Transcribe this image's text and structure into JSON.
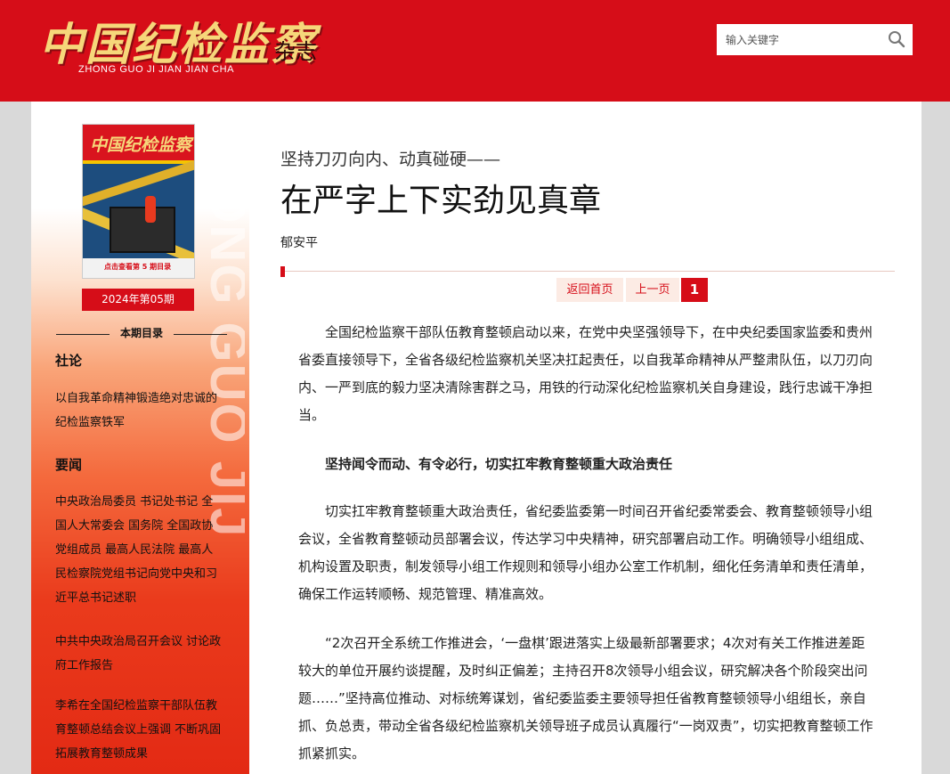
{
  "header": {
    "logo_cn": "中国纪检监察",
    "logo_pinyin": "ZHONG GUO JI JIAN JIAN CHA",
    "logo_suffix": "杂志",
    "search_placeholder": "输入关键字",
    "brand_color": "#d60d18"
  },
  "sidebar": {
    "watermark": "ZHONG GUO JIJ",
    "cover": {
      "title": "中国纪检监察",
      "link_text": "点击查看第 5 期目录"
    },
    "issue_label": "2024年第05期",
    "toc_title": "本期目录",
    "sections": [
      {
        "name": "社论",
        "items": [
          "以自我革命精神锻造绝对忠诚的纪检监察铁军"
        ]
      },
      {
        "name": "要闻",
        "items": [
          "中央政治局委员 书记处书记 全国人大常委会 国务院 全国政协党组成员 最高人民法院 最高人民检察院党组书记向党中央和习近平总书记述职",
          "中共中央政治局召开会议 讨论政府工作报告",
          "李希在全国纪检监察干部队伍教育整顿总结会议上强调 不断巩固拓展教育整顿成果"
        ]
      }
    ]
  },
  "article": {
    "kicker": "坚持刀刃向内、动真碰硬——",
    "title": "在严字上下实劲见真章",
    "author": "郁安平",
    "pager": {
      "home": "返回首页",
      "prev": "上一页",
      "current": "1"
    },
    "paragraphs": [
      "全国纪检监察干部队伍教育整顿启动以来，在党中央坚强领导下，在中央纪委国家监委和贵州省委直接领导下，全省各级纪检监察机关坚决扛起责任，以自我革命精神从严整肃队伍，以刀刃向内、一严到底的毅力坚决清除害群之马，用铁的行动深化纪检监察机关自身建设，践行忠诚干净担当。",
      "坚持闻令而动、有令必行，切实扛牢教育整顿重大政治责任",
      "切实扛牢教育整顿重大政治责任，省纪委监委第一时间召开省纪委常委会、教育整顿领导小组会议，全省教育整顿动员部署会议，传达学习中央精神，研究部署启动工作。明确领导小组组成、机构设置及职责，制发领导小组工作规则和领导小组办公室工作机制，细化任务清单和责任清单，确保工作运转顺畅、规范管理、精准高效。",
      "“2次召开全系统工作推进会，‘一盘棋’跟进落实上级最新部署要求；4次对有关工作推进差距较大的单位开展约谈提醒，及时纠正偏差；主持召开8次领导小组会议，研究解决各个阶段突出问题……”坚持高位推动、对标统筹谋划，省纪委监委主要领导担任省教育整顿领导小组组长，亲自抓、负总责，带动全省各级纪检监察机关领导班子成员认真履行“一岗双责”，切实把教育整顿工作抓紧抓实。"
    ]
  }
}
